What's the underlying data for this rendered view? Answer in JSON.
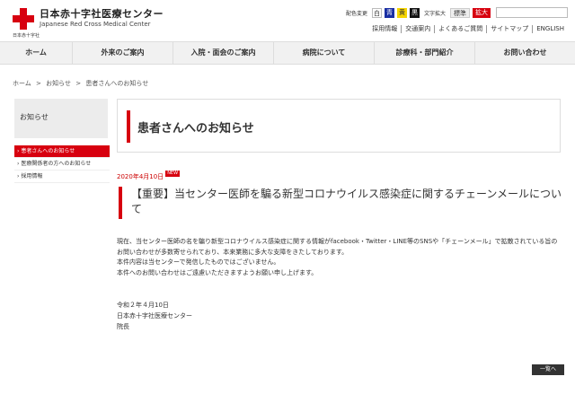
{
  "header": {
    "logo_jp": "日本赤十字社医療センター",
    "logo_en": "Japanese Red Cross Medical Center",
    "logo_small": "日本赤十字社",
    "color_label": "配色変更",
    "colors": [
      "白",
      "青",
      "黄",
      "黒"
    ],
    "font_label": "文字拡大",
    "font_standard": "標準",
    "font_large": "拡大",
    "search_placeholder": "",
    "sublinks": [
      "採用情報",
      "交通案内",
      "よくあるご質問",
      "サイトマップ",
      "ENGLISH"
    ]
  },
  "gnav": [
    "ホーム",
    "外来のご案内",
    "入院・面会のご案内",
    "病院について",
    "診療科・部門紹介",
    "お問い合わせ"
  ],
  "breadcrumb": [
    "ホーム",
    ">",
    "お知らせ",
    ">",
    "患者さんへのお知らせ"
  ],
  "sidebar": {
    "title": "お知らせ",
    "items": [
      "患者さんへのお知らせ",
      "医療関係者の方へのお知らせ",
      "採用情報"
    ]
  },
  "main": {
    "heading": "患者さんへのお知らせ",
    "date": "2020年4月10日",
    "new_badge": "NEW",
    "article_title": "【重要】当センター医師を騙る新型コロナウイルス感染症に関するチェーンメールについて",
    "body": [
      "現在、当センター医師の名を騙り新型コロナウイルス感染症に関する情報がfacebook・Twitter・LINE等のSNSや「チェーンメール」で拡散されている旨のお問い合わせが多数寄せられており、本来業務に多大な支障をきたしております。",
      "本件内容は当センターで発信したものではございません。",
      "本件へのお問い合わせはご遠慮いただきますようお願い申し上げます。"
    ],
    "sign": [
      "令和２年４月10日",
      "日本赤十字社医療センター",
      "院長"
    ],
    "back_label": "一覧へ"
  },
  "colors": {
    "accent": "#d7000f"
  }
}
